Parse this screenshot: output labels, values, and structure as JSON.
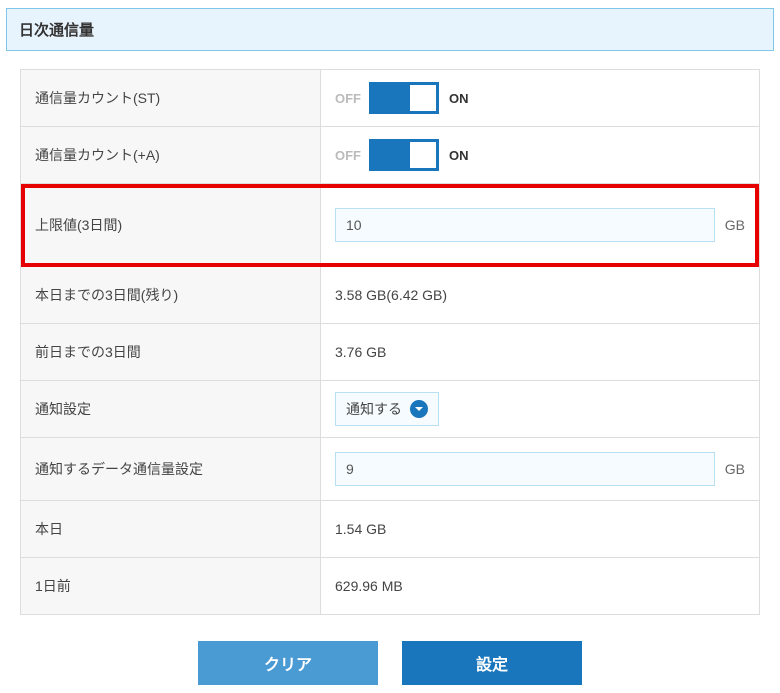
{
  "header": {
    "title": "日次通信量"
  },
  "rows": {
    "count_st": {
      "label": "通信量カウント(ST)",
      "off": "OFF",
      "on": "ON"
    },
    "count_a": {
      "label": "通信量カウント(+A)",
      "off": "OFF",
      "on": "ON"
    },
    "limit": {
      "label": "上限値(3日間)",
      "value": "10",
      "unit": "GB"
    },
    "remain": {
      "label": "本日までの3日間(残り)",
      "value": "3.58 GB(6.42 GB)"
    },
    "prev3": {
      "label": "前日までの3日間",
      "value": "3.76 GB"
    },
    "notify": {
      "label": "通知設定",
      "select_value": "通知する"
    },
    "notify_amt": {
      "label": "通知するデータ通信量設定",
      "value": "9",
      "unit": "GB"
    },
    "today": {
      "label": "本日",
      "value": "1.54 GB"
    },
    "yesterday": {
      "label": "1日前",
      "value": "629.96 MB"
    }
  },
  "buttons": {
    "clear": "クリア",
    "apply": "設定"
  }
}
